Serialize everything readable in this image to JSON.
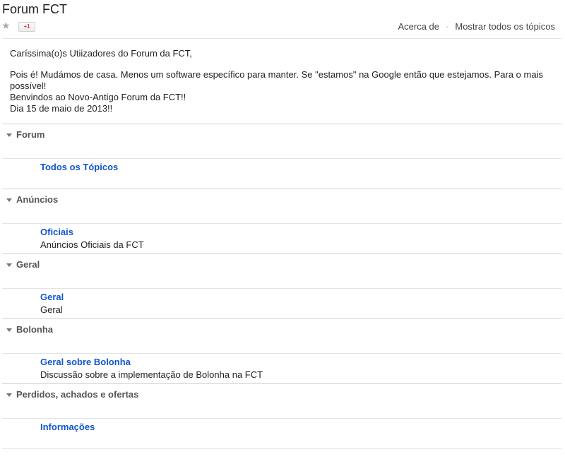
{
  "header": {
    "title": "Forum FCT",
    "plus_one_label": "+1",
    "links": {
      "about": "Acerca de",
      "separator": "·",
      "show_all": "Mostrar todos os tópicos"
    }
  },
  "message": {
    "lines": [
      "Caríssima(o)s Utiizadores do Forum da FCT,",
      "",
      "Pois é! Mudámos de casa. Menos um software específico para manter. Se \"estamos\" na Google então que estejamos. Para o mais possível!",
      "Benvindos ao Novo-Antigo Forum da FCT!!",
      "Dia 15 de maio de 2013!!"
    ]
  },
  "sections": [
    {
      "name": "Forum",
      "groups": [
        {
          "title": "Todos os Tópicos",
          "description": ""
        }
      ]
    },
    {
      "name": "Anúncios",
      "groups": [
        {
          "title": "Oficiais",
          "description": "Anúncios Oficiais da FCT"
        }
      ]
    },
    {
      "name": "Geral",
      "groups": [
        {
          "title": "Geral",
          "description": "Geral"
        }
      ]
    },
    {
      "name": "Bolonha",
      "groups": [
        {
          "title": "Geral sobre Bolonha",
          "description": "Discussão sobre a implementação de Bolonha na FCT"
        }
      ]
    },
    {
      "name": "Perdidos, achados e ofertas",
      "groups": [
        {
          "title": "Informações",
          "description": ""
        }
      ]
    }
  ],
  "colors": {
    "link": "#1155cc",
    "section_header": "#555555",
    "divider": "#e4e4e4"
  }
}
